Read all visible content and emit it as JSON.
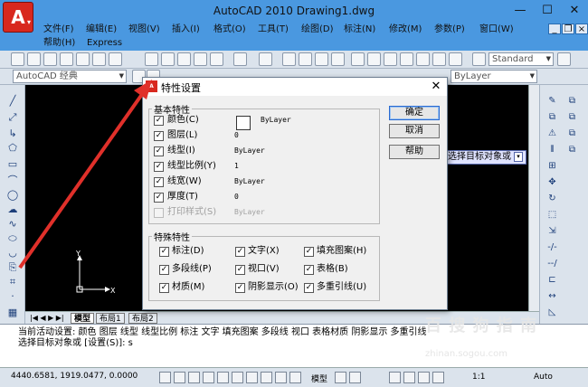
{
  "window": {
    "title": "AutoCAD 2010     Drawing1.dwg",
    "minimize": "—",
    "maximize": "☐",
    "close": "✕"
  },
  "menu": [
    "文件(F)",
    "编辑(E)",
    "视图(V)",
    "插入(I)",
    "格式(O)",
    "工具(T)",
    "绘图(D)",
    "标注(N)",
    "修改(M)",
    "参数(P)",
    "窗口(W)",
    "帮助(H)",
    "Express"
  ],
  "toolbar": {
    "workspace": "AutoCAD 经典",
    "text_style": "Standard",
    "layer_linetype": "ByLayer"
  },
  "dialog": {
    "title": "特性设置",
    "close": "✕",
    "basic_group": "基本特性",
    "special_group": "特殊特性",
    "basic": [
      {
        "label": "颜色(C)",
        "value": "ByLayer",
        "checked": "✓",
        "enabled": true
      },
      {
        "label": "图层(L)",
        "value": "0",
        "checked": "✓",
        "enabled": true
      },
      {
        "label": "线型(I)",
        "value": "ByLayer",
        "checked": "✓",
        "enabled": true
      },
      {
        "label": "线型比例(Y)",
        "value": "1",
        "checked": "✓",
        "enabled": true
      },
      {
        "label": "线宽(W)",
        "value": "ByLayer",
        "checked": "✓",
        "enabled": true
      },
      {
        "label": "厚度(T)",
        "value": "0",
        "checked": "✓",
        "enabled": true
      },
      {
        "label": "打印样式(S)",
        "value": "ByLayer",
        "checked": "",
        "enabled": false
      }
    ],
    "special": [
      {
        "label": "标注(D)",
        "checked": "✓"
      },
      {
        "label": "文字(X)",
        "checked": "✓"
      },
      {
        "label": "填充图案(H)",
        "checked": "✓"
      },
      {
        "label": "多段线(P)",
        "checked": "✓"
      },
      {
        "label": "视口(V)",
        "checked": "✓"
      },
      {
        "label": "表格(B)",
        "checked": "✓"
      },
      {
        "label": "材质(M)",
        "checked": "✓"
      },
      {
        "label": "阴影显示(O)",
        "checked": "✓"
      },
      {
        "label": "多重引线(U)",
        "checked": "✓"
      }
    ],
    "buttons": {
      "ok": "确定",
      "cancel": "取消",
      "help": "帮助"
    }
  },
  "prompt_tip": "选择目标对象或",
  "layout_tabs": [
    "模型",
    "布局1",
    "布局2"
  ],
  "command": {
    "line1": "当前活动设置:  颜色 图层 线型 线型比例 标注 文字 填充图案 多段线 视口 表格材质 阴影显示 多重引线",
    "line2": "选择目标对象或 [设置(S)]: s"
  },
  "status": {
    "coords": "4440.6581, 1919.0477, 0.0000",
    "model": "模型",
    "scale": "1:1",
    "auto": "Auto"
  },
  "watermark": {
    "line1": "百 搜 狗 指 南",
    "line2": "zhinan.sogou.com"
  },
  "colors": {
    "accent_red": "#e0302a",
    "title_blue": "#4a98e0"
  }
}
